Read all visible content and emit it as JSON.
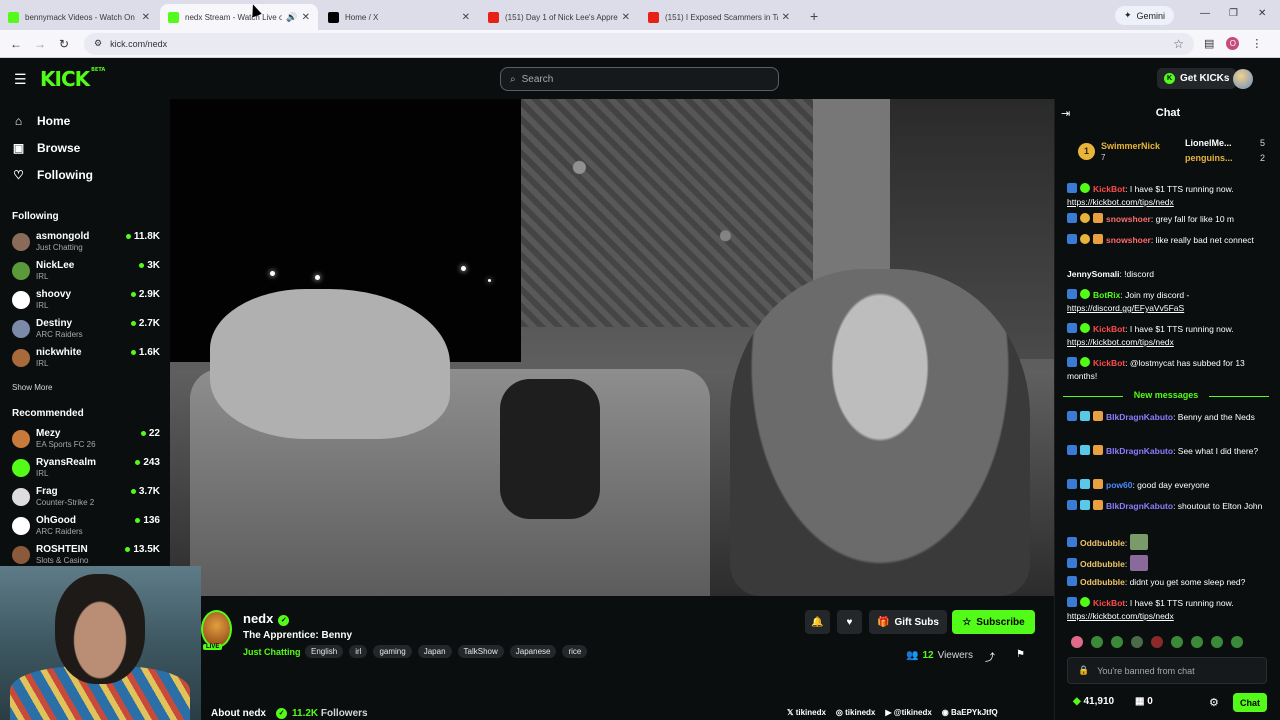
{
  "browser": {
    "tabs": [
      {
        "title": "bennymack Videos - Watch On",
        "favicon_color": "#53fc18"
      },
      {
        "title": "nedx Stream - Watch Live o",
        "favicon_color": "#53fc18"
      },
      {
        "title": "Home / X",
        "favicon_color": "#000000"
      },
      {
        "title": "(151) Day 1 of Nick Lee's Appre",
        "favicon_color": "#e62117"
      },
      {
        "title": "(151) I Exposed Scammers in Ta",
        "favicon_color": "#e62117"
      }
    ],
    "gemini_label": "Gemini",
    "url": "kick.com/nedx",
    "profile_initial": "O"
  },
  "header": {
    "logo": "KICK",
    "logo_badge": "BETA",
    "search_placeholder": "Search",
    "get_kicks_label": "Get KICKs"
  },
  "sidebar": {
    "nav": [
      {
        "label": "Home",
        "icon": "home-icon"
      },
      {
        "label": "Browse",
        "icon": "browse-icon"
      },
      {
        "label": "Following",
        "icon": "heart-icon"
      }
    ],
    "following_heading": "Following",
    "following": [
      {
        "name": "asmongold",
        "category": "Just Chatting",
        "viewers": "11.8K",
        "avatar_color": "#8a6a58"
      },
      {
        "name": "NickLee",
        "category": "IRL",
        "viewers": "3K",
        "avatar_color": "#5a9a3a"
      },
      {
        "name": "shoovy",
        "category": "IRL",
        "viewers": "2.9K",
        "avatar_color": "#ffffff"
      },
      {
        "name": "Destiny",
        "category": "ARC Raiders",
        "viewers": "2.7K",
        "avatar_color": "#7a8aa8"
      },
      {
        "name": "nickwhite",
        "category": "IRL",
        "viewers": "1.6K",
        "avatar_color": "#a86a3a"
      }
    ],
    "show_more": "Show More",
    "recommended_heading": "Recommended",
    "recommended": [
      {
        "name": "Mezy",
        "category": "EA Sports FC 26",
        "viewers": "22",
        "avatar_color": "#c87a3a"
      },
      {
        "name": "RyansRealm",
        "category": "IRL",
        "viewers": "243",
        "avatar_color": "#53fc18"
      },
      {
        "name": "Frag",
        "category": "Counter-Strike 2",
        "viewers": "3.7K",
        "avatar_color": "#dddddd"
      },
      {
        "name": "OhGood",
        "category": "ARC Raiders",
        "viewers": "136",
        "avatar_color": "#ffffff"
      },
      {
        "name": "ROSHTEIN",
        "category": "Slots & Casino",
        "viewers": "13.5K",
        "avatar_color": "#8a5a3a"
      }
    ]
  },
  "stream": {
    "channel": "nedx",
    "live_badge": "LIVE",
    "title": "The Apprentice: Benny",
    "category": "Just Chatting",
    "tags": [
      "English",
      "irl",
      "gaming",
      "Japan",
      "TalkShow",
      "Japanese",
      "rice"
    ],
    "gift_subs_label": "Gift Subs",
    "subscribe_label": "Subscribe",
    "viewers_count": "12",
    "viewers_label": "Viewers",
    "about_label": "About nedx",
    "followers_count": "11.2K",
    "followers_label": "Followers",
    "socials": [
      {
        "icon": "x-icon",
        "label": "tikinedx"
      },
      {
        "icon": "instagram-icon",
        "label": "tikinedx"
      },
      {
        "icon": "youtube-icon",
        "label": "@tikinedx"
      },
      {
        "icon": "discord-icon",
        "label": "BaEPYkJtfQ"
      }
    ]
  },
  "chat": {
    "title": "Chat",
    "leaderboard": {
      "rank": "1",
      "first": {
        "name": "SwimmerNick",
        "count": "7"
      },
      "second": {
        "name": "LionelMe...",
        "count": "5"
      },
      "third": {
        "name": "penguins...",
        "count": "2"
      }
    },
    "messages": [
      {
        "user": "KickBot",
        "color": "#ff4b4b",
        "text": ": I have $1 TTS running now. ",
        "link": "https://kickbot.com/tips/nedx"
      },
      {
        "user": "snowshoer",
        "color": "#ff6b6b",
        "text": ": grey fall for like 10 m",
        "link": ""
      },
      {
        "user": "snowshoer",
        "color": "#ff6b6b",
        "text": ": like really bad net connect",
        "link": ""
      },
      {
        "user": "JennySomali",
        "color": "#ffffff",
        "text": ": !discord",
        "link": ""
      },
      {
        "user": "BotRix",
        "color": "#53fc18",
        "text": ": Join my discord - ",
        "link": "https://discord.gg/EFyaVv5FaS"
      },
      {
        "user": "KickBot",
        "color": "#ff4b4b",
        "text": ": I have $1 TTS running now. ",
        "link": "https://kickbot.com/tips/nedx"
      },
      {
        "user": "KickBot",
        "color": "#ff4b4b",
        "text": ": @lostmycat has subbed for 13 months!",
        "link": ""
      }
    ],
    "new_messages_label": "New messages",
    "new_messages": [
      {
        "user": "BlkDragnKabuto",
        "color": "#8f7bff",
        "text": ": Benny and the Neds",
        "link": ""
      },
      {
        "user": "BlkDragnKabuto",
        "color": "#8f7bff",
        "text": ": See what I did there?",
        "link": ""
      },
      {
        "user": "pow60",
        "color": "#4b8bff",
        "text": ": good day everyone",
        "link": ""
      },
      {
        "user": "BlkDragnKabuto",
        "color": "#8f7bff",
        "text": ": shoutout to Elton John",
        "link": ""
      },
      {
        "user": "Oddbubble",
        "color": "#f0c36a",
        "text": ":",
        "link": ""
      },
      {
        "user": "Oddbubble",
        "color": "#f0c36a",
        "text": ":",
        "link": ""
      },
      {
        "user": "Oddbubble",
        "color": "#f0c36a",
        "text": ": didnt you get some sleep ned?",
        "link": ""
      },
      {
        "user": "KickBot",
        "color": "#ff4b4b",
        "text": ": I have $1 TTS running now. ",
        "link": "https://kickbot.com/tips/nedx"
      }
    ],
    "input_placeholder": "You're banned from chat",
    "kicks_balance": "41,910",
    "gifts_count": "0",
    "chat_button_label": "Chat"
  },
  "colors": {
    "kick_green": "#53fc18",
    "background": "#0b0e0f"
  }
}
